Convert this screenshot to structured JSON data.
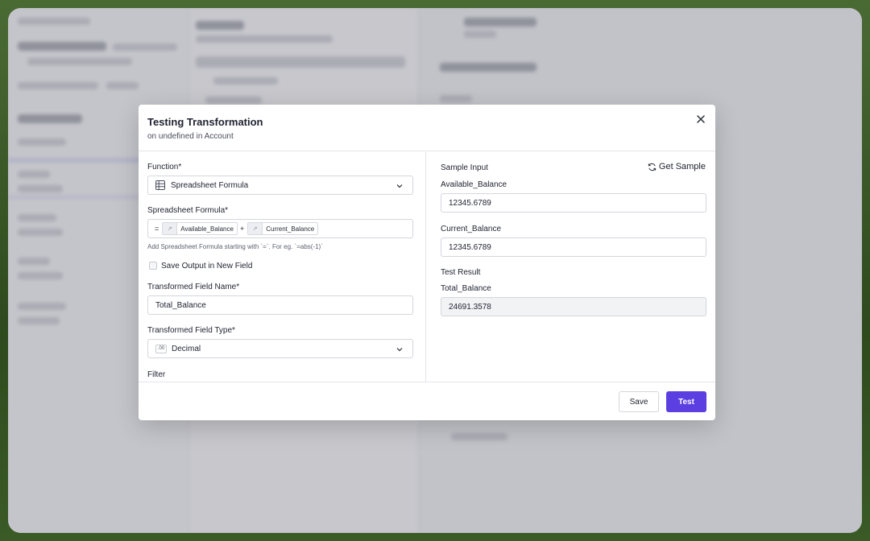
{
  "modal": {
    "title": "Testing Transformation",
    "subtitle": "on undefined in Account"
  },
  "left": {
    "function_label": "Function*",
    "function_value": "Spreadsheet Formula",
    "formula_label": "Spreadsheet Formula*",
    "formula": {
      "prefix": "=",
      "operator": "+",
      "tokens": [
        "Available_Balance",
        "Current_Balance"
      ]
    },
    "formula_hint": "Add Spreadsheet Formula starting with `=`. For eg. `=abs(-1)`",
    "save_output_label": "Save Output in New Field",
    "field_name_label": "Transformed Field Name*",
    "field_name_value": "Total_Balance",
    "field_type_label": "Transformed Field Type*",
    "field_type_value": "Decimal",
    "field_type_icon_text": ".00",
    "filter_label": "Filter"
  },
  "right": {
    "sample_input_label": "Sample Input",
    "get_sample_label": "Get Sample",
    "available_balance_label": "Available_Balance",
    "available_balance_value": "12345.6789",
    "current_balance_label": "Current_Balance",
    "current_balance_value": "12345.6789",
    "test_result_label": "Test Result",
    "total_balance_label": "Total_Balance",
    "total_balance_value": "24691.3578"
  },
  "footer": {
    "save_label": "Save",
    "test_label": "Test"
  },
  "colors": {
    "primary": "#5b3fe0",
    "border": "#d4d6dc",
    "text": "#1f2230"
  }
}
